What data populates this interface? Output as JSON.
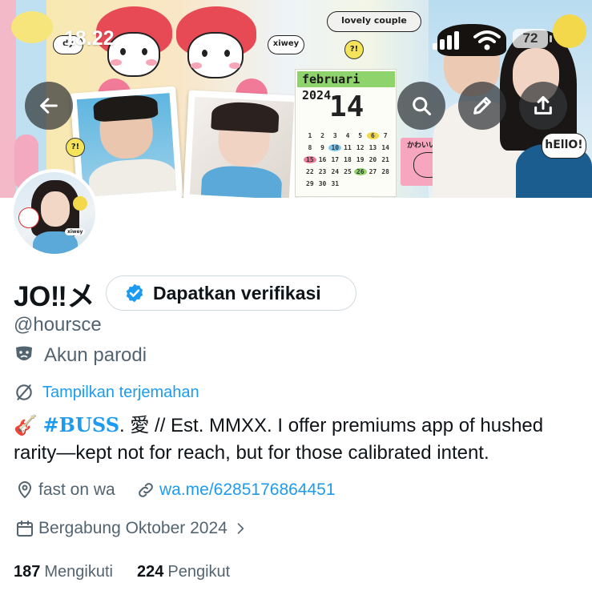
{
  "status_bar": {
    "time": "18.22",
    "battery": "72"
  },
  "banner": {
    "sticker_couple": "lovely couple",
    "sticker_dy": "dy",
    "sticker_xiwey": "xiwey",
    "sticker_q": "?!",
    "calendar_month": "februari 2024",
    "calendar_big_number": "14",
    "calendar_days": [
      "1",
      "2",
      "3",
      "4",
      "5",
      "6",
      "7",
      "8",
      "9",
      "10",
      "11",
      "12",
      "13",
      "14",
      "15",
      "16",
      "17",
      "18",
      "19",
      "20",
      "21",
      "22",
      "23",
      "24",
      "25",
      "26",
      "27",
      "28",
      "29",
      "30",
      "31"
    ],
    "note_label": "かわいい",
    "sticker_hello": "hEllO!",
    "avatar_sticker": "xiwey"
  },
  "nav": {
    "back_icon": "arrow-left-icon",
    "search_icon": "search-icon",
    "edit_icon": "pencil-icon",
    "share_icon": "share-icon"
  },
  "profile": {
    "display_name": "JO‼メ",
    "verify_label": "Dapatkan verifikasi",
    "handle": "@hoursce",
    "parody_label": "Akun parodi",
    "translate_label": "Tampilkan terjemahan",
    "bio_emoji": "🎸",
    "bio_hashtag": "#BUSS",
    "bio_text": ". 愛 // Est. MMXX. I offer premiums app of hushed rarity—kept not for reach, but for those calibrated intent.",
    "location": "fast on wa",
    "website": "wa.me/6285176864451",
    "joined": "Bergabung Oktober 2024",
    "following_count": "187",
    "following_label": "Mengikuti",
    "followers_count": "224",
    "followers_label": "Pengikut"
  },
  "colors": {
    "accent": "#1d9bf0",
    "secondary_text": "#536471",
    "primary_text": "#0f1419"
  }
}
